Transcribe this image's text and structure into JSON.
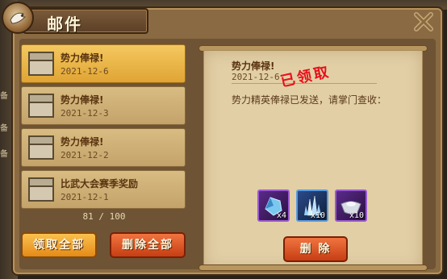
{
  "window": {
    "title": "邮件"
  },
  "background": {
    "side_chars": [
      "备",
      "备",
      "备"
    ]
  },
  "mail_list": {
    "items": [
      {
        "subject": "势力俸禄!",
        "date": "2021-12-6",
        "selected": true
      },
      {
        "subject": "势力俸禄!",
        "date": "2021-12-3",
        "selected": false
      },
      {
        "subject": "势力俸禄!",
        "date": "2021-12-2",
        "selected": false
      },
      {
        "subject": "比武大会赛季奖励",
        "date": "2021-12-1",
        "selected": false
      }
    ],
    "count": "81 / 100",
    "claim_all_label": "领取全部",
    "delete_all_label": "删除全部"
  },
  "letter": {
    "subject": "势力俸禄!",
    "date": "2021-12-6",
    "stamp": "已领取",
    "body": "势力精英俸禄已发送，请掌门查收：",
    "rewards": [
      {
        "icon": "blue-crystal-icon",
        "qty": "x4",
        "frame": "purple"
      },
      {
        "icon": "ice-crystal-icon",
        "qty": "x10",
        "frame": "blue"
      },
      {
        "icon": "silver-ingot-icon",
        "qty": "x10",
        "frame": "purple"
      }
    ],
    "delete_label": "删 除"
  },
  "colors": {
    "frame": "#8a6a42",
    "selected_item": "#f4c860",
    "item": "#d8bc82",
    "stamp": "#e8101a",
    "claim_button": "#e48a18",
    "delete_button": "#c73e14"
  }
}
